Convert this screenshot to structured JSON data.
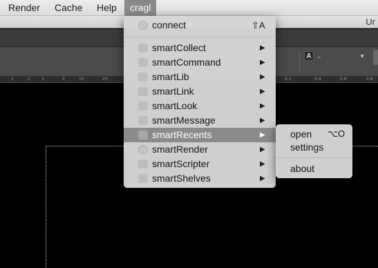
{
  "menubar": {
    "items": [
      {
        "label": "Render"
      },
      {
        "label": "Cache"
      },
      {
        "label": "Help"
      },
      {
        "label": "cragl"
      }
    ]
  },
  "window": {
    "title_fragment": "Ur"
  },
  "toolbar": {
    "font_badge": "A",
    "font_select_value": "-"
  },
  "ruler": {
    "ticks": [
      "1",
      "2",
      "3",
      "5",
      "10",
      "20",
      "0.3",
      "0.4",
      "0.6",
      "0.8"
    ]
  },
  "cragl_menu": {
    "items": [
      {
        "label": "connect",
        "icon": "connect-icon",
        "shortcut": "⇧A"
      },
      {
        "label": "smartCollect",
        "icon": "smartcollect-icon",
        "submenu_arrow": "▶"
      },
      {
        "label": "smartCommand",
        "icon": "smartcommand-icon",
        "submenu_arrow": "▶"
      },
      {
        "label": "smartLib",
        "icon": "smartlib-icon",
        "submenu_arrow": "▶"
      },
      {
        "label": "smartLink",
        "icon": "smartlink-icon",
        "submenu_arrow": "▶"
      },
      {
        "label": "smartLook",
        "icon": "smartlook-icon",
        "submenu_arrow": "▶"
      },
      {
        "label": "smartMessage",
        "icon": "smartmessage-icon",
        "submenu_arrow": "▶"
      },
      {
        "label": "smartRecents",
        "icon": "smartrecents-icon",
        "submenu_arrow": "▶",
        "highlighted": true
      },
      {
        "label": "smartRender",
        "icon": "smartrender-icon",
        "submenu_arrow": "▶"
      },
      {
        "label": "smartScripter",
        "icon": "smartscripter-icon",
        "submenu_arrow": "▶"
      },
      {
        "label": "smartShelves",
        "icon": "smartshelves-icon",
        "submenu_arrow": "▶"
      }
    ]
  },
  "recents_submenu": {
    "items": [
      {
        "label": "open",
        "shortcut": "⌥O"
      },
      {
        "label": "settings"
      },
      {
        "label": "about"
      }
    ]
  }
}
